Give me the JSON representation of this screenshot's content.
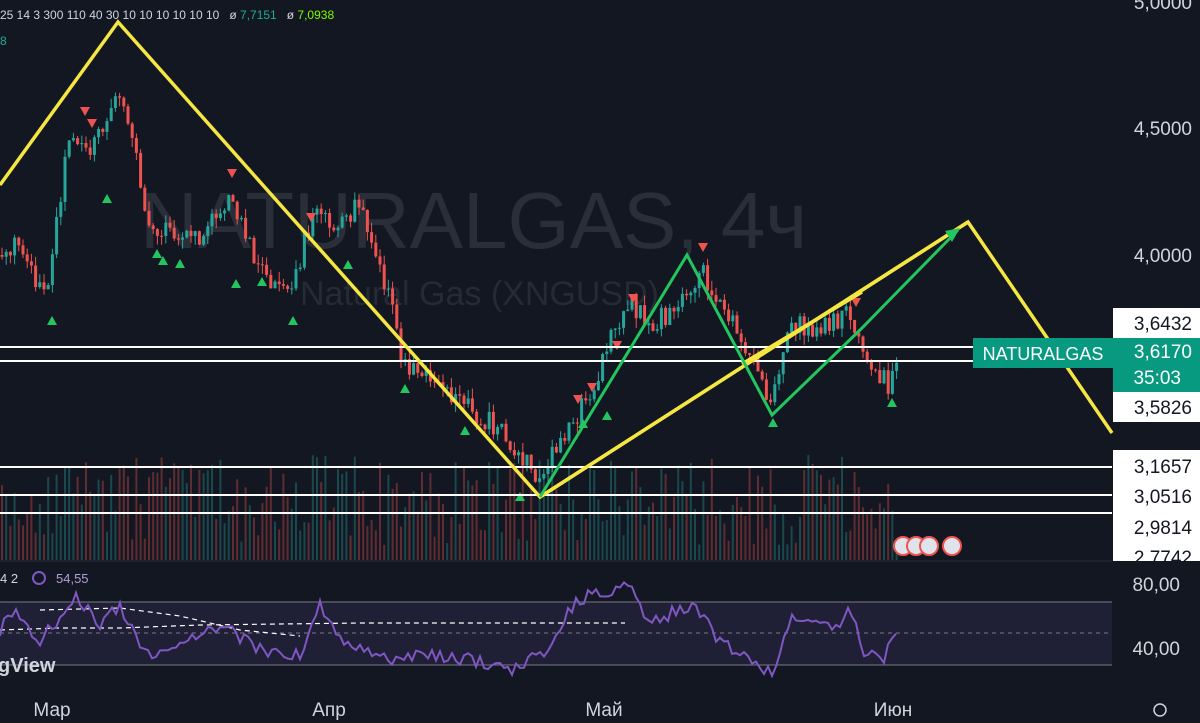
{
  "header": {
    "params": "25 14 3 300 110 40 30 10 10 10 10 10 10",
    "sym1": "ø",
    "val1": "7,7151",
    "sym2": "ø",
    "val2": "7,0938",
    "side_fragment": "8"
  },
  "watermark": {
    "title": "NATURALGAS, 4ч",
    "subtitle": "Natural Gas (XNGUSD)"
  },
  "rsi_label": {
    "params": "4 2",
    "value": "54,55"
  },
  "branding": "gView",
  "price_axis": {
    "ticks": [
      "5,0000",
      "4,5000",
      "4,0000"
    ],
    "bottom_tick": "2,7742"
  },
  "levels": [
    {
      "label": "3,6432",
      "price": 3.6432
    },
    {
      "label": "3,5826",
      "price": 3.5826
    },
    {
      "label": "3,1657",
      "price": 3.1657
    },
    {
      "label": "3,0516",
      "price": 3.0516
    },
    {
      "label": "2,9814",
      "price": 2.9814
    }
  ],
  "current": {
    "symbol": "NATURALGAS",
    "price": "3,6170",
    "countdown": "35:03",
    "color": "#089981"
  },
  "rsi_axis": [
    "80,00",
    "40,00"
  ],
  "x_axis": [
    "Мар",
    "Апр",
    "Май",
    "Июн"
  ],
  "colors": {
    "background": "#131722",
    "up": "#26a69a",
    "down": "#ef5350",
    "zigzag": "#f5e642",
    "pattern": "#22c55e",
    "rsi": "#7e57c2"
  },
  "chart_data": {
    "type": "candlestick",
    "title": "NATURALGAS, 4ч",
    "subtitle": "Natural Gas (XNGUSD)",
    "price_range": [
      2.74,
      5.0
    ],
    "zigzag_yellow": [
      {
        "date": "Feb-25",
        "price": 4.3
      },
      {
        "date": "Mar-10",
        "price": 4.92
      },
      {
        "date": "Apr-25",
        "price": 3.05
      },
      {
        "date": "Jun-05",
        "price": 4.12
      },
      {
        "date": "Jun-12",
        "price": 3.3
      }
    ],
    "channel_lines": [
      {
        "from": {
          "date": "Apr-25",
          "price": 3.05
        },
        "to": {
          "date": "Jun-05",
          "price": 4.12
        }
      },
      {
        "from": {
          "date": "May-08",
          "price": 3.6
        },
        "to": {
          "date": "May-28",
          "price": 3.83
        }
      }
    ],
    "pattern_green": [
      {
        "date": "Apr-25",
        "price": 3.05
      },
      {
        "date": "May-05",
        "price": 4.0
      },
      {
        "date": "May-15",
        "price": 3.44
      },
      {
        "date": "May-28",
        "price": 3.85
      },
      {
        "date": "Jun-05",
        "price": 4.1
      }
    ],
    "rsi_range": [
      0,
      100
    ],
    "rsi_levels": [
      70,
      50,
      30
    ],
    "rsi_value": 54.55
  }
}
